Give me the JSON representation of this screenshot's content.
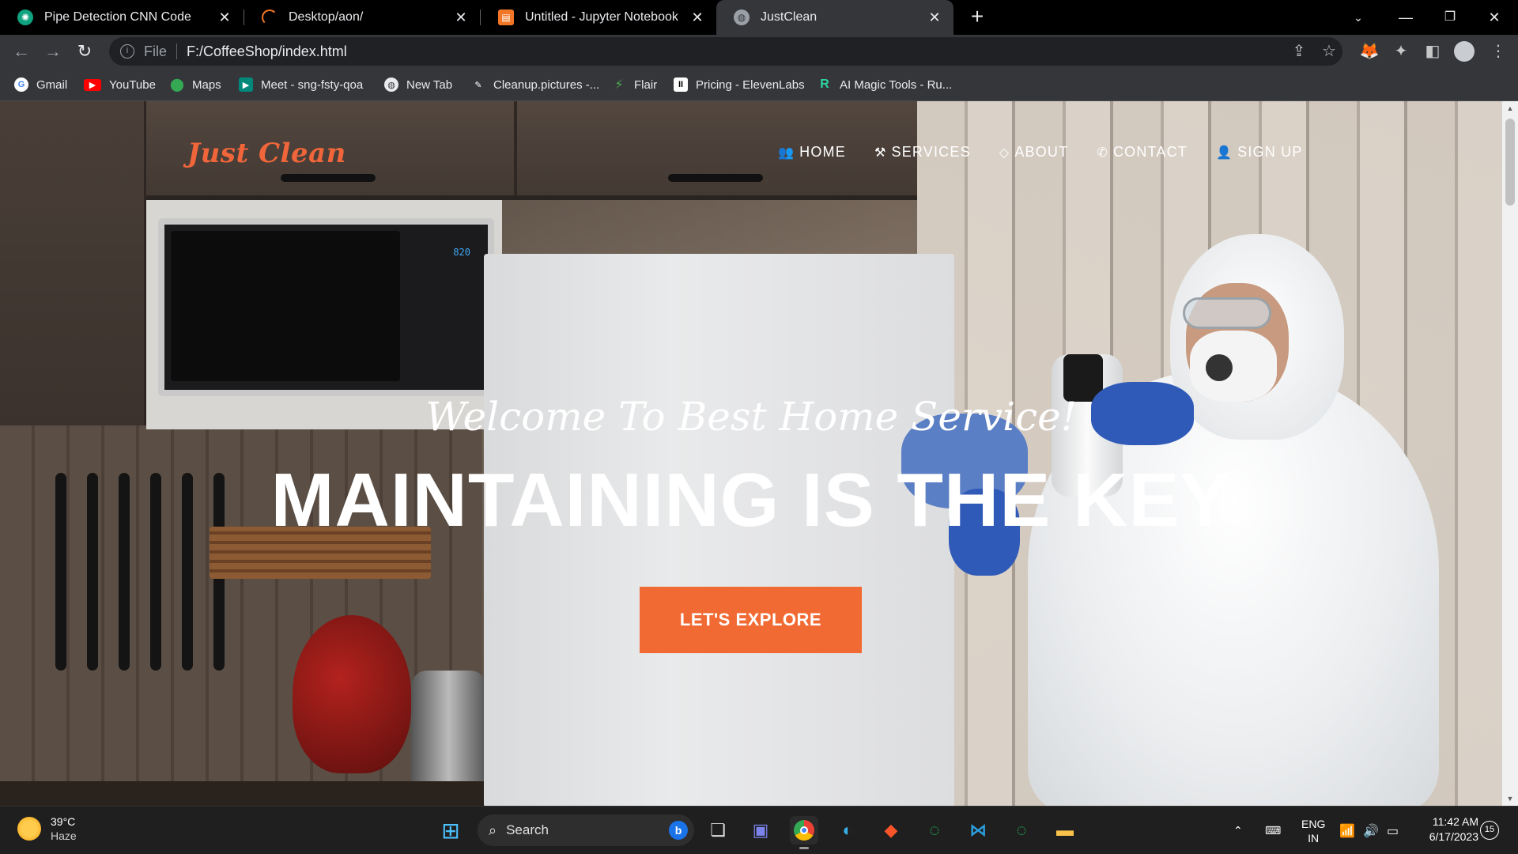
{
  "browser": {
    "tabs": [
      {
        "title": "Pipe Detection CNN Code",
        "icon": "chatgpt-icon",
        "active": false
      },
      {
        "title": "Desktop/aon/",
        "icon": "jupyter-icon",
        "active": false
      },
      {
        "title": "Untitled - Jupyter Notebook",
        "icon": "notebook-icon",
        "active": false
      },
      {
        "title": "JustClean",
        "icon": "globe-icon",
        "active": true
      }
    ],
    "new_tab_label": "+",
    "address": {
      "scheme": "File",
      "url": "F:/CoffeeShop/index.html"
    },
    "bookmarks": [
      {
        "label": "Gmail",
        "icon": "google-icon"
      },
      {
        "label": "YouTube",
        "icon": "youtube-icon"
      },
      {
        "label": "Maps",
        "icon": "maps-icon"
      },
      {
        "label": "Meet - sng-fsty-qoa",
        "icon": "meet-icon"
      },
      {
        "label": "New Tab",
        "icon": "globe-icon"
      },
      {
        "label": "Cleanup.pictures -...",
        "icon": "brush-icon"
      },
      {
        "label": "Flair",
        "icon": "flair-icon"
      },
      {
        "label": "Pricing - ElevenLabs",
        "icon": "elevenlabs-icon"
      },
      {
        "label": "AI Magic Tools - Ru...",
        "icon": "runway-icon"
      }
    ]
  },
  "site": {
    "logo": "Just Clean",
    "nav": [
      {
        "label": "HOME",
        "icon": "users-icon"
      },
      {
        "label": "SERVICES",
        "icon": "hammer-icon"
      },
      {
        "label": "ABOUT",
        "icon": "diamond-icon"
      },
      {
        "label": "CONTACT",
        "icon": "phone-icon"
      },
      {
        "label": "SIGN UP",
        "icon": "user-icon"
      }
    ],
    "hero": {
      "welcome": "Welcome To Best Home Service!",
      "title": "MAINTAINING IS THE KEY",
      "cta": "LET'S EXPLORE"
    },
    "microwave_display": "820",
    "accent_color": "#f26a33"
  },
  "taskbar": {
    "weather": {
      "temp": "39°C",
      "condition": "Haze"
    },
    "search_placeholder": "Search",
    "language": {
      "line1": "ENG",
      "line2": "IN"
    },
    "time": "11:42 AM",
    "date": "6/17/2023",
    "notification_count": "15"
  }
}
